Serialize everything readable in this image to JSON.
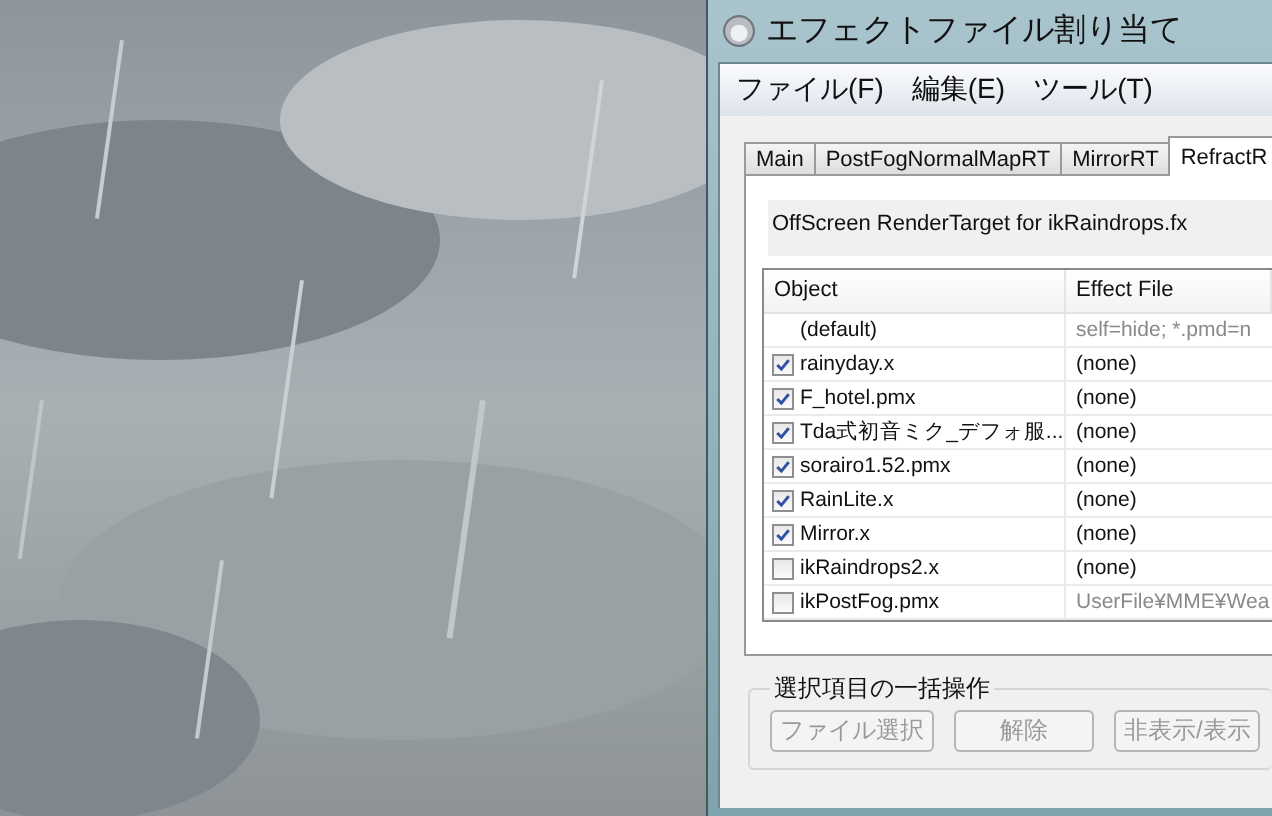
{
  "window": {
    "title": "エフェクトファイル割り当て"
  },
  "menu": [
    "ファイル(F)",
    "編集(E)",
    "ツール(T)"
  ],
  "tabs": [
    {
      "label": "Main",
      "selected": false
    },
    {
      "label": "PostFogNormalMapRT",
      "selected": false
    },
    {
      "label": "MirrorRT",
      "selected": false
    },
    {
      "label": "RefractR",
      "selected": true
    }
  ],
  "description": "OffScreen RenderTarget for ikRaindrops.fx",
  "table": {
    "columns": [
      "Object",
      "Effect File"
    ],
    "rows": [
      {
        "kind": "default",
        "object": "(default)",
        "effect": "self=hide; *.pmd=n",
        "dimmed": true
      },
      {
        "kind": "item",
        "checked": true,
        "object": "rainyday.x",
        "effect": "(none)",
        "dimmed": false
      },
      {
        "kind": "item",
        "checked": true,
        "object": "F_hotel.pmx",
        "effect": "(none)",
        "dimmed": false
      },
      {
        "kind": "item",
        "checked": true,
        "object": "Tda式初音ミク_デフォ服...",
        "effect": "(none)",
        "dimmed": false
      },
      {
        "kind": "item",
        "checked": true,
        "object": "sorairo1.52.pmx",
        "effect": "(none)",
        "dimmed": false
      },
      {
        "kind": "item",
        "checked": true,
        "object": "RainLite.x",
        "effect": "(none)",
        "dimmed": false
      },
      {
        "kind": "item",
        "checked": true,
        "object": "Mirror.x",
        "effect": "(none)",
        "dimmed": false
      },
      {
        "kind": "item",
        "checked": false,
        "object": "ikRaindrops2.x",
        "effect": "(none)",
        "dimmed": false
      },
      {
        "kind": "item",
        "checked": false,
        "object": "ikPostFog.pmx",
        "effect": "UserFile¥MME¥Wea",
        "dimmed": true
      }
    ]
  },
  "batch": {
    "title": "選択項目の一括操作",
    "buttons": [
      {
        "label": "ファイル選択",
        "disabled": true
      },
      {
        "label": "解除",
        "disabled": true
      },
      {
        "label": "非表示/表示",
        "disabled": true
      }
    ]
  }
}
